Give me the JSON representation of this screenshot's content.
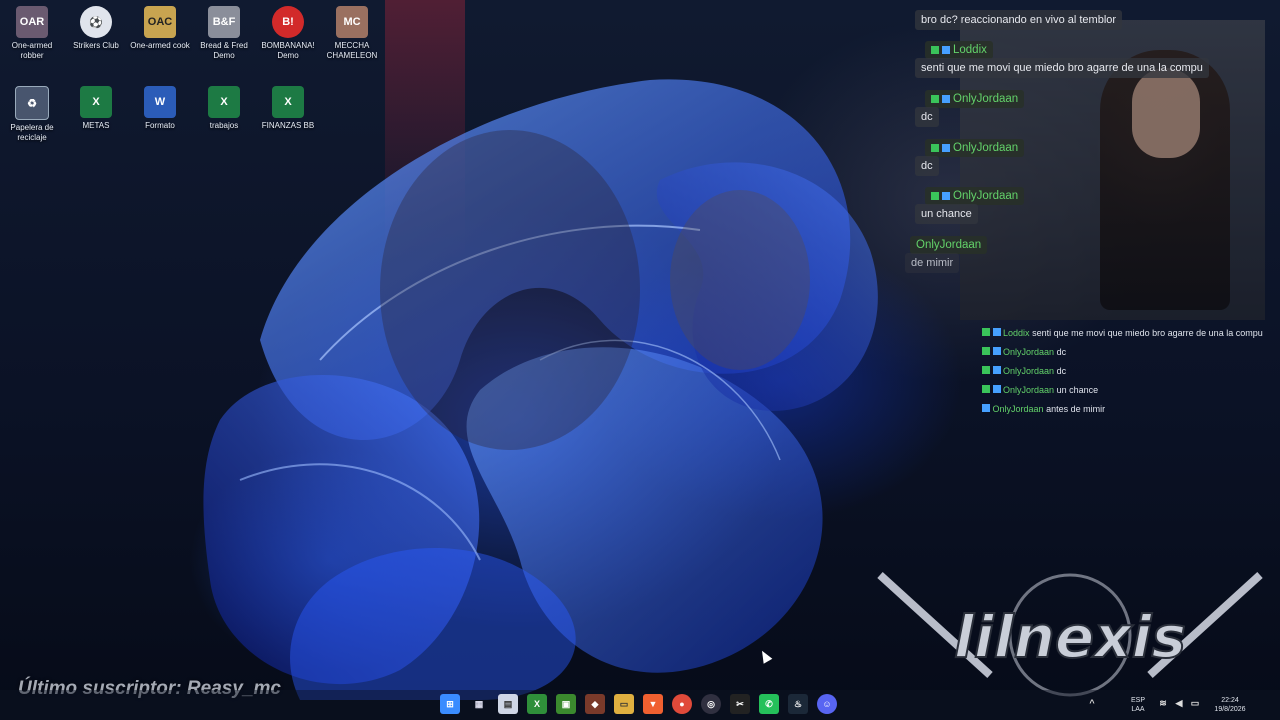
{
  "desktop": {
    "icons": [
      {
        "label": "One-armed robber",
        "icon": "game-icon"
      },
      {
        "label": "Strikers Club",
        "icon": "shield-icon"
      },
      {
        "label": "One-armed cook",
        "icon": "game-icon"
      },
      {
        "label": "Bread & Fred Demo",
        "icon": "game-icon"
      },
      {
        "label": "BOMBANANA! Demo",
        "icon": "game-icon"
      },
      {
        "label": "MECCHA CHAMELEON",
        "icon": "game-icon"
      },
      {
        "label": "Papelera de reciclaje",
        "icon": "recycle-bin-icon"
      },
      {
        "label": "METAS",
        "icon": "excel-icon"
      },
      {
        "label": "Formato",
        "icon": "word-icon"
      },
      {
        "label": "trabajos",
        "icon": "excel-icon"
      },
      {
        "label": "FINANZAS BB",
        "icon": "excel-icon"
      }
    ]
  },
  "chat_overlay": {
    "messages": [
      {
        "user": "OnlyJordaan",
        "text": "bro dc? reaccionando en vivo al temblor"
      },
      {
        "user": "Loddix",
        "text": "senti que me movi que miedo bro agarre de una la compu"
      },
      {
        "user": "OnlyJordaan",
        "text": "dc"
      },
      {
        "user": "OnlyJordaan",
        "text": "dc"
      },
      {
        "user": "OnlyJordaan",
        "text": "un chance"
      },
      {
        "user": "OnlyJordaan",
        "text": "de mimir"
      }
    ]
  },
  "chat_log": {
    "lines": [
      {
        "user": "Loddix",
        "text": "senti que me movi que miedo bro agarre de una la compu"
      },
      {
        "user": "OnlyJordaan",
        "text": "dc"
      },
      {
        "user": "OnlyJordaan",
        "text": "dc"
      },
      {
        "user": "OnlyJordaan",
        "text": "un chance"
      },
      {
        "user": "OnlyJordaan",
        "text": "antes de mimir"
      }
    ]
  },
  "overlay": {
    "subscriber_text": "Último suscriptor: Reasy_mc",
    "logo_text": "lilnexis"
  },
  "taskbar": {
    "apps": [
      "start-icon",
      "task-view-icon",
      "notepad-icon",
      "xbox-icon",
      "minecraft-icon",
      "game-icon",
      "file-explorer-icon",
      "brave-icon",
      "chrome-icon",
      "obs-icon",
      "capcut-icon",
      "whatsapp-icon",
      "steam-icon",
      "discord-icon"
    ],
    "language": "ESP",
    "keyboard": "LAA",
    "time": "22:24",
    "date": "19/8/2026"
  },
  "colors": {
    "chat_name": "#63d26a",
    "accent_blue": "#3060ff"
  }
}
